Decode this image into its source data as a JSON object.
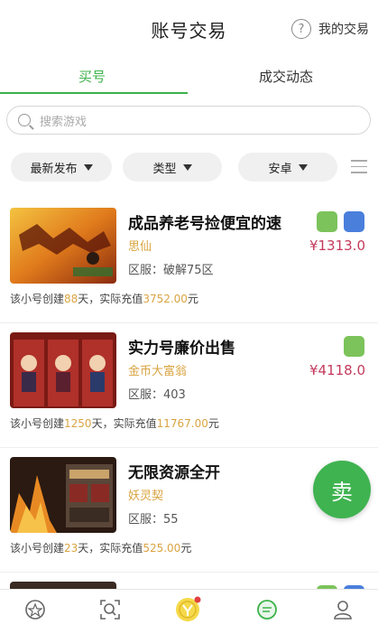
{
  "header": {
    "title": "账号交易",
    "help_icon": "?",
    "help_label": "我的交易"
  },
  "tabs": [
    {
      "label": "买号",
      "active": true
    },
    {
      "label": "成交动态",
      "active": false
    }
  ],
  "search": {
    "placeholder": "搜索游戏"
  },
  "filters": [
    {
      "label": "最新发布"
    },
    {
      "label": "类型"
    },
    {
      "label": "安卓"
    }
  ],
  "listings": [
    {
      "title": "成品养老号捡便宜的速",
      "game": "思仙",
      "region": "区服：破解75区",
      "price": "¥1313.0",
      "platforms": [
        "android",
        "ios"
      ],
      "meta_prefix": "该小号创建",
      "days": "88",
      "meta_mid": "天，实际充值",
      "recharge": "3752.00",
      "meta_suffix": "元"
    },
    {
      "title": "实力号廉价出售",
      "game": "金币大富翁",
      "region": "区服：403",
      "price": "¥4118.0",
      "platforms": [
        "android"
      ],
      "meta_prefix": "该小号创建",
      "days": "1250",
      "meta_mid": "天，实际充值",
      "recharge": "11767.00",
      "meta_suffix": "元"
    },
    {
      "title": "无限资源全开",
      "game": "妖灵契",
      "region": "区服：55",
      "price": "",
      "platforms": [],
      "meta_prefix": "该小号创建",
      "days": "23",
      "meta_mid": "天，实际充值",
      "recharge": "525.00",
      "meta_suffix": "元"
    }
  ],
  "sell_button": {
    "label": "卖"
  },
  "colors": {
    "accent": "#3db24a",
    "price": "#c43a5c",
    "highlight": "#d9a441",
    "android": "#7cc35b",
    "ios": "#4a7fdc"
  }
}
